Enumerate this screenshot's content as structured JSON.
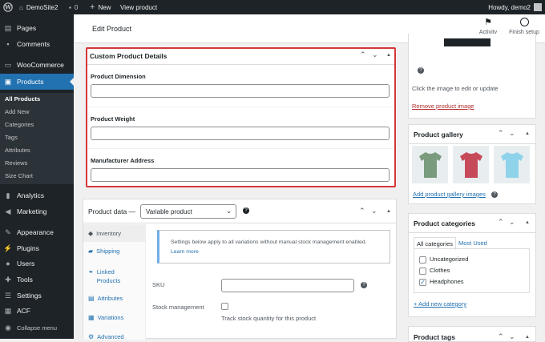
{
  "admin_bar": {
    "site_name": "DemoSite2",
    "comments_count": "0",
    "new_label": "New",
    "view_label": "View product",
    "howdy": "Howdy, demo2"
  },
  "sidebar": {
    "items": [
      {
        "label": "Pages",
        "icon": "pages-icon"
      },
      {
        "label": "Comments",
        "icon": "comments-icon"
      },
      {
        "label": "WooCommerce",
        "icon": "woocommerce-icon"
      },
      {
        "label": "Products",
        "icon": "products-icon"
      },
      {
        "label": "Analytics",
        "icon": "analytics-icon"
      },
      {
        "label": "Marketing",
        "icon": "marketing-icon"
      },
      {
        "label": "Appearance",
        "icon": "appearance-icon"
      },
      {
        "label": "Plugins",
        "icon": "plugins-icon"
      },
      {
        "label": "Users",
        "icon": "users-icon"
      },
      {
        "label": "Tools",
        "icon": "tools-icon"
      },
      {
        "label": "Settings",
        "icon": "settings-icon"
      },
      {
        "label": "ACF",
        "icon": "acf-icon"
      },
      {
        "label": "Collapse menu",
        "icon": "collapse-icon"
      }
    ],
    "submenu": [
      "All Products",
      "Add New",
      "Categories",
      "Tags",
      "Attributes",
      "Reviews",
      "Size Chart"
    ]
  },
  "header": {
    "title": "Edit Product",
    "activity_label": "Activity",
    "finish_setup_label": "Finish setup"
  },
  "custom_details": {
    "title": "Custom Product Details",
    "fields": [
      {
        "label": "Product Dimension",
        "value": ""
      },
      {
        "label": "Product Weight",
        "value": ""
      },
      {
        "label": "Manufacturer Address",
        "value": ""
      }
    ]
  },
  "product_data": {
    "title": "Product data —",
    "type_selected": "Variable product",
    "tabs": [
      "Inventory",
      "Shipping",
      "Linked Products",
      "Attributes",
      "Variations",
      "Advanced"
    ],
    "notice": "Settings below apply to all variations without manual stock management enabled.",
    "learn_more": "Learn more",
    "sku_label": "SKU",
    "sku_value": "",
    "stock_label": "Stock management",
    "stock_desc": "Track stock quantity for this product"
  },
  "product_image": {
    "help": "Click the image to edit or update",
    "remove": "Remove product image"
  },
  "gallery": {
    "title": "Product gallery",
    "add_link": "Add product gallery images",
    "thumb_colors": [
      "#7a9b7e",
      "#c64a5a",
      "#8fd3ea"
    ]
  },
  "categories": {
    "title": "Product categories",
    "tab_all": "All categories",
    "tab_used": "Most Used",
    "items": [
      {
        "label": "Uncategorized",
        "checked": false
      },
      {
        "label": "Clothes",
        "checked": false
      },
      {
        "label": "Headphones",
        "checked": true
      }
    ],
    "add_link": "+ Add new category"
  },
  "tags": {
    "title": "Product tags"
  },
  "colors": {
    "accent": "#2271b1",
    "admin_dark": "#1d2327",
    "highlight": "#d63638"
  }
}
